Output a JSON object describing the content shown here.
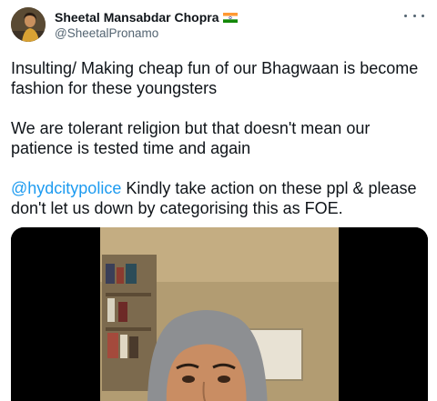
{
  "author": {
    "display_name": "Sheetal Mansabdar Chopra",
    "handle": "@SheetalPronamo",
    "flag_icon": "india-flag-icon",
    "avatar_icon": "profile-photo-avatar"
  },
  "menu": {
    "icon": "more-options-icon"
  },
  "tweet": {
    "paragraph1": "Insulting/ Making cheap fun of our Bhagwaan is become fashion for these youngsters",
    "paragraph2": "We are tolerant religion but that doesn't mean our patience is tested time and again",
    "mention": "@hydcitypolice",
    "paragraph3_rest": " Kindly take action on these ppl & please don't let us down by categorising this as FOE."
  },
  "media": {
    "type": "video-thumbnail"
  },
  "colors": {
    "link": "#1d9bf0",
    "text": "#0f1419",
    "secondary": "#536471"
  }
}
